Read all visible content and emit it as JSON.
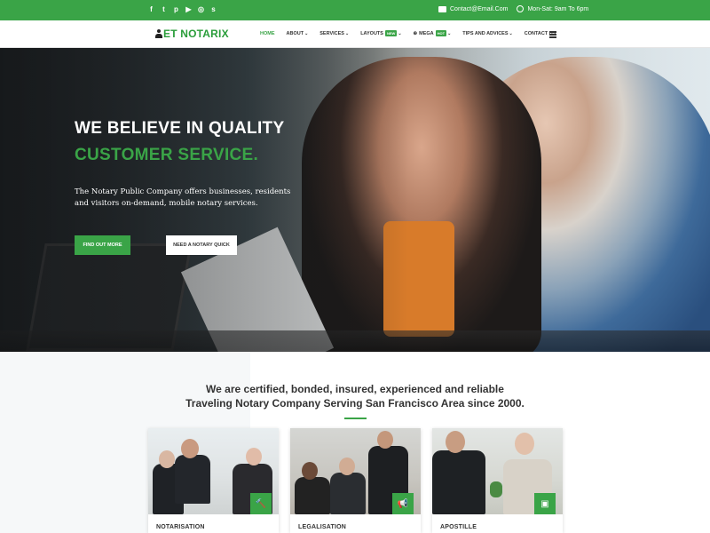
{
  "topbar": {
    "social_icons": [
      "facebook-icon",
      "twitter-icon",
      "pinterest-icon",
      "youtube-icon",
      "instagram-icon",
      "skype-icon"
    ],
    "social_glyphs": [
      "f",
      "t",
      "p",
      "▶",
      "◎",
      "s"
    ],
    "email": "Contact@Email.Com",
    "hours": "Mon-Sat: 9am To 6pm",
    "bg_color": "#3aa447"
  },
  "nav": {
    "logo": "ET NOTARIX",
    "items": [
      {
        "label": "HOME",
        "active": true,
        "caret": false
      },
      {
        "label": "ABOUT",
        "caret": true
      },
      {
        "label": "SERVICES",
        "caret": true
      },
      {
        "label": "LAYOUTS",
        "badge": "NEW",
        "caret": true
      },
      {
        "label": "MEGA",
        "badge": "HOT",
        "caret": true,
        "icon": "globe-icon"
      },
      {
        "label": "TIPS AND ADVICES",
        "caret": true
      },
      {
        "label": "CONTACT US",
        "caret": false
      }
    ],
    "menu_icon": "hamburger-icon"
  },
  "hero": {
    "title_line1": "WE BELIEVE IN QUALITY",
    "title_line2": "CUSTOMER SERVICE.",
    "lead": "The Notary Public Company offers businesses, residents and visitors on-demand, mobile notary services.",
    "btn_primary": "FIND OUT MORE",
    "btn_secondary": "NEED A NOTARY QUICK"
  },
  "intro": {
    "line1": "We are certified, bonded, insured, experienced and reliable",
    "line2": "Traveling Notary Company Serving San Francisco Area since 2000."
  },
  "cards": [
    {
      "label": "NOTARISATION",
      "icon": "gavel-icon",
      "glyph": "🔨"
    },
    {
      "label": "LEGALISATION",
      "icon": "megaphone-icon",
      "glyph": "📢"
    },
    {
      "label": "APOSTILLE",
      "icon": "archive-icon",
      "glyph": "▣"
    }
  ],
  "accent_color": "#3aa447"
}
